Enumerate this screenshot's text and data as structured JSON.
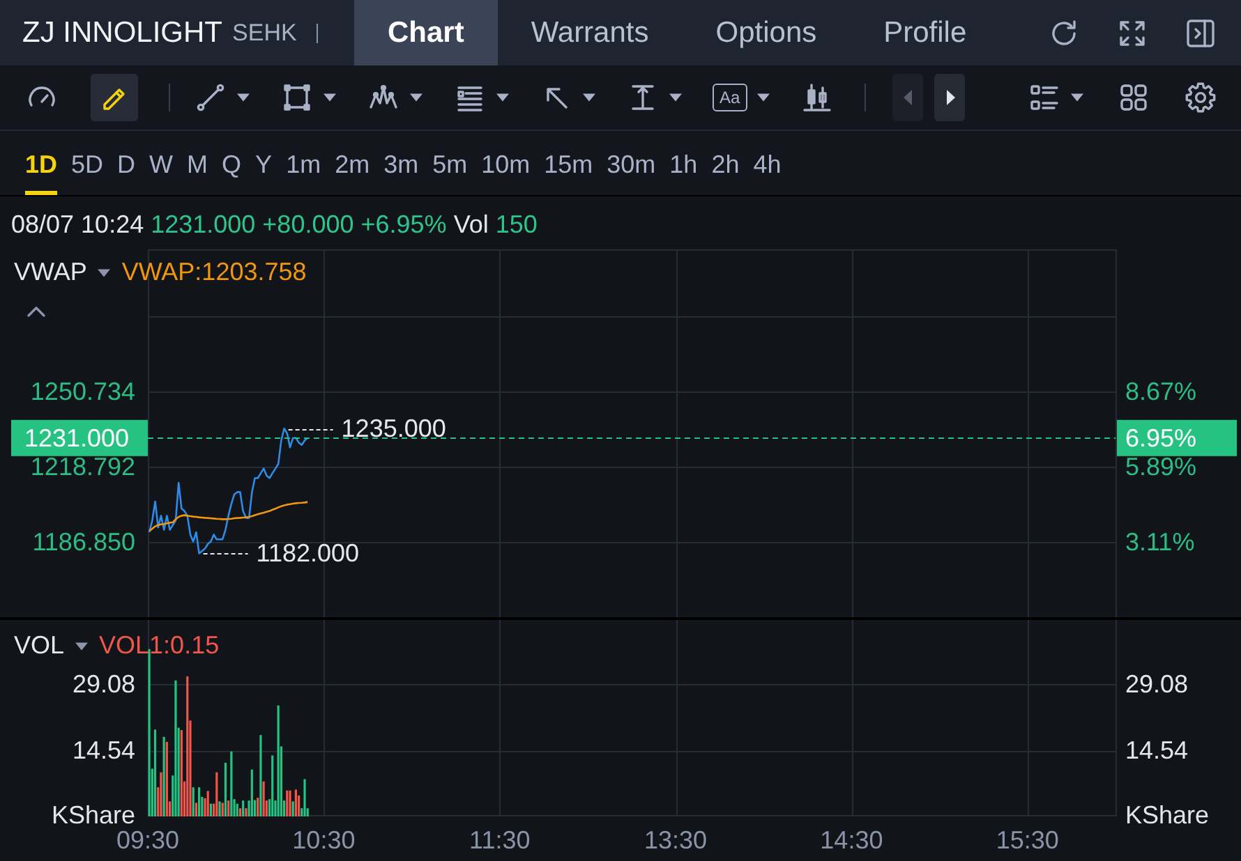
{
  "header": {
    "title": "ZJ INNOLIGHT",
    "exchange": "SEHK"
  },
  "tabs": [
    {
      "label": "Chart",
      "selected": true
    },
    {
      "label": "Warrants",
      "selected": false
    },
    {
      "label": "Options",
      "selected": false
    },
    {
      "label": "Profile",
      "selected": false
    }
  ],
  "toolbar": {
    "tools": [
      {
        "selected": false
      },
      {
        "selected": true
      }
    ],
    "drawing_tools": [
      {
        "menu": true
      },
      {
        "menu": true
      },
      {
        "menu": true
      },
      {
        "menu": true
      },
      {
        "menu": true
      },
      {
        "menu": true
      },
      {
        "label": "Aa",
        "menu": true
      },
      {
        "menu": false
      }
    ],
    "nav_buttons": [
      {
        "disabled": true
      },
      {
        "disabled": false
      }
    ],
    "view_tools": [
      {
        "menu": true
      },
      {
        "menu": false
      },
      {
        "menu": false
      }
    ]
  },
  "periods": [
    {
      "label": "1D",
      "selected": true
    },
    {
      "label": "5D",
      "selected": false
    },
    {
      "label": "D",
      "selected": false
    },
    {
      "label": "W",
      "selected": false
    },
    {
      "label": "M",
      "selected": false
    },
    {
      "label": "Q",
      "selected": false
    },
    {
      "label": "Y",
      "selected": false
    },
    {
      "label": "1m",
      "selected": false
    },
    {
      "label": "2m",
      "selected": false
    },
    {
      "label": "3m",
      "selected": false
    },
    {
      "label": "5m",
      "selected": false
    },
    {
      "label": "10m",
      "selected": false
    },
    {
      "label": "15m",
      "selected": false
    },
    {
      "label": "30m",
      "selected": false
    },
    {
      "label": "1h",
      "selected": false
    },
    {
      "label": "2h",
      "selected": false
    },
    {
      "label": "4h",
      "selected": false
    }
  ],
  "quote": {
    "datetime": "08/07 10:24",
    "price": "1231.000",
    "change": "+80.000",
    "change_percent": "+6.95%",
    "volume_label": "Vol",
    "volume": "150"
  },
  "price_panel": {
    "indicator": "VWAP",
    "legend_value": "VWAP:1203.758",
    "percent_axis": [
      "8.67%",
      "5.89%",
      "3.11%"
    ],
    "last_percent": "6.95%",
    "chart_data": {
      "type": "line",
      "grid": true,
      "categories": [
        null,
        null,
        null,
        null,
        null,
        null,
        null,
        null,
        null,
        null,
        null,
        null,
        null,
        null,
        null,
        null,
        null,
        null,
        null,
        null,
        null,
        null,
        null,
        null,
        null,
        null,
        null,
        null,
        null,
        null,
        null,
        null,
        null,
        null,
        null,
        null,
        null,
        null,
        null,
        null,
        null,
        null,
        null,
        null,
        null,
        null,
        null,
        null,
        null,
        null,
        null,
        null,
        null,
        null,
        null,
        null,
        null,
        null,
        null,
        null,
        null,
        null,
        null,
        null,
        null,
        null,
        null,
        null,
        null,
        null,
        null,
        null,
        null,
        null,
        null,
        null,
        null,
        null,
        null,
        null,
        null,
        null,
        null,
        null,
        null,
        null,
        null,
        null,
        null,
        null,
        null,
        null,
        null,
        null,
        null,
        null,
        null,
        null,
        null,
        null,
        null,
        null,
        null,
        null,
        null,
        null,
        null,
        null,
        null,
        null,
        null,
        null,
        null,
        null,
        null,
        null,
        null,
        null,
        null,
        null,
        null,
        null,
        null,
        null,
        null,
        null,
        null,
        null,
        null,
        null,
        null,
        null,
        null,
        null,
        null,
        null,
        null,
        null,
        null,
        null,
        null,
        null,
        null,
        null,
        null,
        null,
        null,
        null,
        null,
        null,
        null,
        null,
        null,
        null,
        null,
        null,
        null,
        null,
        null,
        null,
        null,
        null,
        null,
        null,
        null,
        null,
        null,
        null,
        null,
        null,
        null,
        null,
        null,
        null,
        null,
        null,
        null,
        null,
        null,
        null,
        null,
        null,
        null,
        null,
        null,
        null,
        null,
        null,
        null,
        null,
        null,
        null,
        null,
        null,
        null,
        null,
        null,
        null,
        null,
        null,
        null,
        null,
        null,
        null,
        null,
        null,
        null,
        null,
        null,
        null,
        null,
        null,
        null,
        null,
        null,
        null,
        null,
        null,
        null,
        null,
        null,
        null,
        null,
        null,
        null,
        null,
        null,
        null,
        null,
        null,
        null,
        null,
        null,
        null,
        null,
        null,
        null,
        null,
        null,
        null,
        null,
        null,
        null,
        null,
        null,
        null,
        null,
        null,
        null,
        null,
        null,
        null,
        null,
        null,
        null,
        null,
        null,
        null,
        null,
        null,
        null,
        null,
        null,
        null,
        null,
        null,
        null,
        null,
        null,
        null,
        null,
        null,
        null,
        null,
        null,
        null,
        null,
        null,
        null,
        null,
        null,
        null,
        null,
        null,
        null,
        null,
        null,
        null,
        null,
        null,
        null,
        null,
        null,
        null,
        null,
        null,
        null,
        null,
        null,
        null,
        null,
        null,
        null,
        null,
        null,
        null,
        null,
        null,
        null,
        null,
        null,
        null,
        null,
        null,
        null,
        null,
        null,
        null,
        null,
        null,
        null,
        null,
        null,
        null,
        null,
        null,
        null,
        null,
        null,
        null
      ],
      "series": [
        {
          "color": "#2f8be6",
          "values": [
            1191,
            1196,
            1204,
            1193,
            1198,
            1192,
            1198,
            1192,
            1194,
            1196,
            1212,
            1201,
            1200,
            1198,
            1190,
            1187,
            1191,
            1182,
            1183,
            1184,
            1186,
            1187,
            1190,
            1188,
            1188,
            1188,
            1192,
            1198,
            1203,
            1207,
            1208,
            1208,
            1200,
            1197,
            1197,
            1208,
            1214,
            1214,
            1216,
            1218,
            1215,
            1214,
            1216,
            1218,
            1220,
            1230,
            1235,
            1233,
            1227,
            1231,
            1231,
            1229,
            1228,
            1230,
            1231,
            null,
            null,
            null,
            null,
            null,
            null,
            null,
            null,
            null,
            null,
            null,
            null,
            null,
            null,
            null,
            null,
            null,
            null,
            null,
            null,
            null,
            null,
            null,
            null,
            null,
            null,
            null,
            null,
            null,
            null,
            null,
            null,
            null,
            null,
            null,
            null,
            null,
            null,
            null,
            null,
            null,
            null,
            null,
            null,
            null,
            null,
            null,
            null,
            null,
            null,
            null,
            null,
            null,
            null,
            null,
            null,
            null,
            null,
            null,
            null,
            null,
            null,
            null,
            null,
            null,
            null,
            null,
            null,
            null,
            null,
            null,
            null,
            null,
            null,
            null,
            null,
            null,
            null,
            null,
            null,
            null,
            null,
            null,
            null,
            null,
            null,
            null,
            null,
            null,
            null,
            null,
            null,
            null,
            null,
            null,
            null,
            null,
            null,
            null,
            null,
            null,
            null,
            null,
            null,
            null,
            null,
            null,
            null,
            null,
            null,
            null,
            null,
            null,
            null,
            null,
            null,
            null,
            null,
            null,
            null,
            null,
            null,
            null,
            null,
            null,
            null,
            null,
            null,
            null,
            null,
            null,
            null,
            null,
            null,
            null,
            null,
            null,
            null,
            null,
            null,
            null,
            null,
            null,
            null,
            null,
            null,
            null,
            null,
            null,
            null,
            null,
            null,
            null,
            null,
            null,
            null,
            null,
            null,
            null,
            null,
            null,
            null,
            null,
            null,
            null,
            null,
            null,
            null,
            null,
            null,
            null,
            null,
            null,
            null,
            null,
            null,
            null,
            null,
            null,
            null,
            null,
            null,
            null,
            null,
            null,
            null,
            null,
            null,
            null,
            null,
            null,
            null,
            null,
            null,
            null,
            null,
            null,
            null,
            null,
            null,
            null,
            null,
            null,
            null,
            null,
            null,
            null,
            null,
            null,
            null,
            null,
            null,
            null,
            null,
            null,
            null,
            null,
            null,
            null,
            null,
            null,
            null,
            null,
            null,
            null,
            null,
            null,
            null,
            null,
            null,
            null,
            null,
            null,
            null,
            null,
            null,
            null,
            null,
            null,
            null,
            null,
            null,
            null,
            null,
            null,
            null,
            null,
            null,
            null,
            null,
            null,
            null,
            null,
            null,
            null,
            null,
            null,
            null,
            null,
            null,
            null,
            null,
            null,
            null,
            null,
            null,
            null,
            null,
            null,
            null,
            null,
            null,
            null,
            null,
            null
          ]
        },
        {
          "color": "#f0960f",
          "values": [
            1191.5,
            1192.5,
            1193.5,
            1194,
            1194.3,
            1194.5,
            1194.8,
            1195,
            1195.2,
            1196.5,
            1197.5,
            1198,
            1198.2,
            1198,
            1197.8,
            1197.6,
            1197.5,
            1197.3,
            1197.2,
            1197.1,
            1197,
            1196.9,
            1196.8,
            1196.7,
            1196.6,
            1196.5,
            1196.5,
            1196.6,
            1196.7,
            1196.9,
            1197,
            1197.1,
            1197.2,
            1197.3,
            1197.5,
            1197.8,
            1198.2,
            1198.6,
            1199,
            1199.3,
            1199.6,
            1200,
            1200.5,
            1201,
            1201.5,
            1202,
            1202.4,
            1202.7,
            1202.9,
            1203.1,
            1203.3,
            1203.4,
            1203.5,
            1203.6,
            1203.8,
            null,
            null,
            null,
            null,
            null,
            null,
            null,
            null,
            null,
            null,
            null,
            null,
            null,
            null,
            null,
            null,
            null,
            null,
            null,
            null,
            null,
            null,
            null,
            null,
            null,
            null,
            null,
            null,
            null,
            null,
            null,
            null,
            null,
            null,
            null,
            null,
            null,
            null,
            null,
            null,
            null,
            null,
            null,
            null,
            null,
            null,
            null,
            null,
            null,
            null,
            null,
            null,
            null,
            null,
            null,
            null,
            null,
            null,
            null,
            null,
            null,
            null,
            null,
            null,
            null,
            null,
            null,
            null,
            null,
            null,
            null,
            null,
            null,
            null,
            null,
            null,
            null,
            null,
            null,
            null,
            null,
            null,
            null,
            null,
            null,
            null,
            null,
            null,
            null,
            null,
            null,
            null,
            null,
            null,
            null,
            null,
            null,
            null,
            null,
            null,
            null,
            null,
            null,
            null,
            null,
            null,
            null,
            null,
            null,
            null,
            null,
            null,
            null,
            null,
            null,
            null,
            null,
            null,
            null,
            null,
            null,
            null,
            null,
            null,
            null,
            null,
            null,
            null,
            null,
            null,
            null,
            null,
            null,
            null,
            null,
            null,
            null,
            null,
            null,
            null,
            null,
            null,
            null,
            null,
            null,
            null,
            null,
            null,
            null,
            null,
            null,
            null,
            null,
            null,
            null,
            null,
            null,
            null,
            null,
            null,
            null,
            null,
            null,
            null,
            null,
            null,
            null,
            null,
            null,
            null,
            null,
            null,
            null,
            null,
            null,
            null,
            null,
            null,
            null,
            null,
            null,
            null,
            null,
            null,
            null,
            null,
            null,
            null,
            null,
            null,
            null,
            null,
            null,
            null,
            null,
            null,
            null,
            null,
            null,
            null,
            null,
            null,
            null,
            null,
            null,
            null,
            null,
            null,
            null,
            null,
            null,
            null,
            null,
            null,
            null,
            null,
            null,
            null,
            null,
            null,
            null,
            null,
            null,
            null,
            null,
            null,
            null,
            null,
            null,
            null,
            null,
            null,
            null,
            null,
            null,
            null,
            null,
            null,
            null,
            null,
            null,
            null,
            null,
            null,
            null,
            null,
            null,
            null,
            null,
            null,
            null,
            null,
            null,
            null,
            null,
            null,
            null,
            null,
            null,
            null,
            null,
            null,
            null,
            null,
            null,
            null,
            null,
            null,
            null,
            null,
            null,
            null,
            null,
            null,
            null
          ]
        }
      ],
      "ylim": [
        1154.91,
        1311.07
      ],
      "yticks": [
        {
          "value": 1250.734,
          "label": "1250.734"
        },
        {
          "value": 1218.792,
          "label": "1218.792"
        },
        {
          "value": 1186.85,
          "label": "1186.850"
        }
      ],
      "annotations": [
        "1235.000",
        "1182.000"
      ],
      "ref_lines": [
        {
          "axis": "y",
          "value": 1231,
          "label": "1231.000",
          "color": "#26c281"
        }
      ]
    }
  },
  "volume_panel": {
    "indicator": "VOL",
    "legend_value": "VOL1:0.15",
    "right_axis": [
      "29.08",
      "14.54",
      "KShare"
    ],
    "chart_data": {
      "type": "bar",
      "grid": true,
      "categories": [
        "09:30",
        null,
        null,
        null,
        null,
        null,
        null,
        null,
        null,
        null,
        null,
        null,
        null,
        null,
        null,
        null,
        null,
        null,
        null,
        null,
        null,
        null,
        null,
        null,
        null,
        null,
        null,
        null,
        null,
        null,
        null,
        null,
        null,
        null,
        null,
        null,
        null,
        null,
        null,
        null,
        null,
        null,
        null,
        null,
        null,
        null,
        null,
        null,
        null,
        null,
        null,
        null,
        null,
        null,
        null,
        null,
        null,
        null,
        null,
        null,
        "10:30",
        null,
        null,
        null,
        null,
        null,
        null,
        null,
        null,
        null,
        null,
        null,
        null,
        null,
        null,
        null,
        null,
        null,
        null,
        null,
        null,
        null,
        null,
        null,
        null,
        null,
        null,
        null,
        null,
        null,
        null,
        null,
        null,
        null,
        null,
        null,
        null,
        null,
        null,
        null,
        null,
        null,
        null,
        null,
        null,
        null,
        null,
        null,
        null,
        null,
        null,
        null,
        null,
        null,
        null,
        null,
        null,
        null,
        null,
        null,
        "11:30",
        null,
        null,
        null,
        null,
        null,
        null,
        null,
        null,
        null,
        null,
        null,
        null,
        null,
        null,
        null,
        null,
        null,
        null,
        null,
        null,
        null,
        null,
        null,
        null,
        null,
        null,
        null,
        null,
        null,
        null,
        null,
        null,
        null,
        null,
        null,
        null,
        null,
        null,
        null,
        null,
        null,
        null,
        null,
        null,
        null,
        null,
        null,
        null,
        null,
        null,
        null,
        null,
        null,
        null,
        null,
        null,
        null,
        null,
        null,
        "13:30",
        null,
        null,
        null,
        null,
        null,
        null,
        null,
        null,
        null,
        null,
        null,
        null,
        null,
        null,
        null,
        null,
        null,
        null,
        null,
        null,
        null,
        null,
        null,
        null,
        null,
        null,
        null,
        null,
        null,
        null,
        null,
        null,
        null,
        null,
        null,
        null,
        null,
        null,
        null,
        null,
        null,
        null,
        null,
        null,
        null,
        null,
        null,
        null,
        null,
        null,
        null,
        null,
        null,
        null,
        null,
        null,
        null,
        null,
        null,
        "14:30",
        null,
        null,
        null,
        null,
        null,
        null,
        null,
        null,
        null,
        null,
        null,
        null,
        null,
        null,
        null,
        null,
        null,
        null,
        null,
        null,
        null,
        null,
        null,
        null,
        null,
        null,
        null,
        null,
        null,
        null,
        null,
        null,
        null,
        null,
        null,
        null,
        null,
        null,
        null,
        null,
        null,
        null,
        null,
        null,
        null,
        null,
        null,
        null,
        null,
        null,
        null,
        null,
        null,
        null,
        null,
        null,
        null,
        null,
        null,
        "15:30",
        null,
        null,
        null,
        null,
        null,
        null,
        null,
        null,
        null,
        null,
        null,
        null,
        null,
        null,
        null,
        null,
        null,
        null,
        null,
        null,
        null,
        null,
        null,
        null,
        null,
        null,
        null,
        null,
        null
      ],
      "series": [
        {
          "color": "#26c281",
          "values": [
            36.8,
            10.5,
            19.1,
            null,
            null,
            17.5,
            null,
            null,
            9,
            29.9,
            19.5,
            null,
            null,
            null,
            null,
            6.4,
            null,
            6.4,
            4.3,
            null,
            null,
            2.8,
            null,
            null,
            3.3,
            null,
            11.8,
            null,
            14.3,
            3.8,
            2.8,
            null,
            3.5,
            null,
            3.5,
            10.3,
            3.6,
            null,
            17.9,
            null,
            null,
            3.8,
            13.4,
            3.5,
            24.4,
            15.4,
            3.5,
            null,
            null,
            3.3,
            null,
            null,
            1.8,
            8.2,
            1.8,
            null,
            null,
            null,
            null,
            null,
            null,
            null,
            null,
            null,
            null,
            null,
            null,
            null,
            null,
            null,
            null,
            null,
            null,
            null,
            null,
            null,
            null,
            null,
            null,
            null,
            null,
            null,
            null,
            null,
            null,
            null,
            null,
            null,
            null,
            null,
            null,
            null,
            null,
            null,
            null,
            null,
            null,
            null,
            null,
            null,
            null,
            null,
            null,
            null,
            null,
            null,
            null,
            null,
            null,
            null,
            null,
            null,
            null,
            null,
            null,
            null,
            null,
            null,
            null,
            null,
            null,
            null,
            null,
            null,
            null,
            null,
            null,
            null,
            null,
            null,
            null,
            null,
            null,
            null,
            null,
            null,
            null,
            null,
            null,
            null,
            null,
            null,
            null,
            null,
            null,
            null,
            null,
            null,
            null,
            null,
            null,
            null,
            null,
            null,
            null,
            null,
            null,
            null,
            null,
            null,
            null,
            null,
            null,
            null,
            null,
            null,
            null,
            null,
            null,
            null,
            null,
            null,
            null,
            null,
            null,
            null,
            null,
            null,
            null,
            null,
            null,
            null,
            null,
            null,
            null,
            null,
            null,
            null,
            null,
            null,
            null,
            null,
            null,
            null,
            null,
            null,
            null,
            null,
            null,
            null,
            null,
            null,
            null,
            null,
            null,
            null,
            null,
            null,
            null,
            null,
            null,
            null,
            null,
            null,
            null,
            null,
            null,
            null,
            null,
            null,
            null,
            null,
            null,
            null,
            null,
            null,
            null,
            null,
            null,
            null,
            null,
            null,
            null,
            null,
            null,
            null,
            null,
            null,
            null,
            null,
            null,
            null,
            null,
            null,
            null,
            null,
            null,
            null,
            null,
            null,
            null,
            null,
            null,
            null,
            null,
            null,
            null,
            null,
            null,
            null,
            null,
            null,
            null,
            null,
            null,
            null,
            null,
            null,
            null,
            null,
            null,
            null,
            null,
            null,
            null,
            null,
            null,
            null,
            null,
            null,
            null,
            null,
            null,
            null,
            null,
            null,
            null,
            null,
            null,
            null,
            null,
            null,
            null,
            null,
            null,
            null,
            null,
            null,
            null,
            null,
            null,
            null,
            null,
            null,
            null,
            null,
            null,
            null,
            null,
            null,
            null,
            null,
            null,
            null,
            null,
            null,
            null,
            null,
            null,
            null,
            null,
            null,
            null,
            null,
            null,
            null,
            null,
            null,
            null,
            null
          ]
        },
        {
          "color": "#f0564a",
          "values": [
            null,
            null,
            null,
            6.4,
            9.7,
            null,
            16.4,
            3.3,
            null,
            null,
            null,
            19,
            7.7,
            30.8,
            21.1,
            null,
            3,
            null,
            null,
            4,
            5.6,
            null,
            2.8,
            9.7,
            null,
            3,
            null,
            3.5,
            null,
            null,
            null,
            1.8,
            null,
            1.8,
            null,
            null,
            null,
            4.1,
            null,
            7.7,
            3.5,
            null,
            null,
            null,
            null,
            null,
            null,
            5.7,
            5.7,
            null,
            5.9,
            4.6,
            null,
            null,
            null,
            null,
            null,
            null,
            null,
            null,
            null,
            null,
            null,
            null,
            null,
            null,
            null,
            null,
            null,
            null,
            null,
            null,
            null,
            null,
            null,
            null,
            null,
            null,
            null,
            null,
            null,
            null,
            null,
            null,
            null,
            null,
            null,
            null,
            null,
            null,
            null,
            null,
            null,
            null,
            null,
            null,
            null,
            null,
            null,
            null,
            null,
            null,
            null,
            null,
            null,
            null,
            null,
            null,
            null,
            null,
            null,
            null,
            null,
            null,
            null,
            null,
            null,
            null,
            null,
            null,
            null,
            null,
            null,
            null,
            null,
            null,
            null,
            null,
            null,
            null,
            null,
            null,
            null,
            null,
            null,
            null,
            null,
            null,
            null,
            null,
            null,
            null,
            null,
            null,
            null,
            null,
            null,
            null,
            null,
            null,
            null,
            null,
            null,
            null,
            null,
            null,
            null,
            null,
            null,
            null,
            null,
            null,
            null,
            null,
            null,
            null,
            null,
            null,
            null,
            null,
            null,
            null,
            null,
            null,
            null,
            null,
            null,
            null,
            null,
            null,
            null,
            null,
            null,
            null,
            null,
            null,
            null,
            null,
            null,
            null,
            null,
            null,
            null,
            null,
            null,
            null,
            null,
            null,
            null,
            null,
            null,
            null,
            null,
            null,
            null,
            null,
            null,
            null,
            null,
            null,
            null,
            null,
            null,
            null,
            null,
            null,
            null,
            null,
            null,
            null,
            null,
            null,
            null,
            null,
            null,
            null,
            null,
            null,
            null,
            null,
            null,
            null,
            null,
            null,
            null,
            null,
            null,
            null,
            null,
            null,
            null,
            null,
            null,
            null,
            null,
            null,
            null,
            null,
            null,
            null,
            null,
            null,
            null,
            null,
            null,
            null,
            null,
            null,
            null,
            null,
            null,
            null,
            null,
            null,
            null,
            null,
            null,
            null,
            null,
            null,
            null,
            null,
            null,
            null,
            null,
            null,
            null,
            null,
            null,
            null,
            null,
            null,
            null,
            null,
            null,
            null,
            null,
            null,
            null,
            null,
            null,
            null,
            null,
            null,
            null,
            null,
            null,
            null,
            null,
            null,
            null,
            null,
            null,
            null,
            null,
            null,
            null,
            null,
            null,
            null,
            null,
            null,
            null,
            null,
            null,
            null,
            null,
            null,
            null,
            null,
            null,
            null,
            null,
            null,
            null,
            null,
            null,
            null,
            null,
            null
          ]
        }
      ],
      "ylim": [
        0,
        43.2
      ],
      "yticks": [
        {
          "value": 29.08,
          "label": "29.08"
        },
        {
          "value": 14.54,
          "label": "14.54"
        },
        {
          "value": 0,
          "label": "KShare"
        }
      ]
    }
  }
}
